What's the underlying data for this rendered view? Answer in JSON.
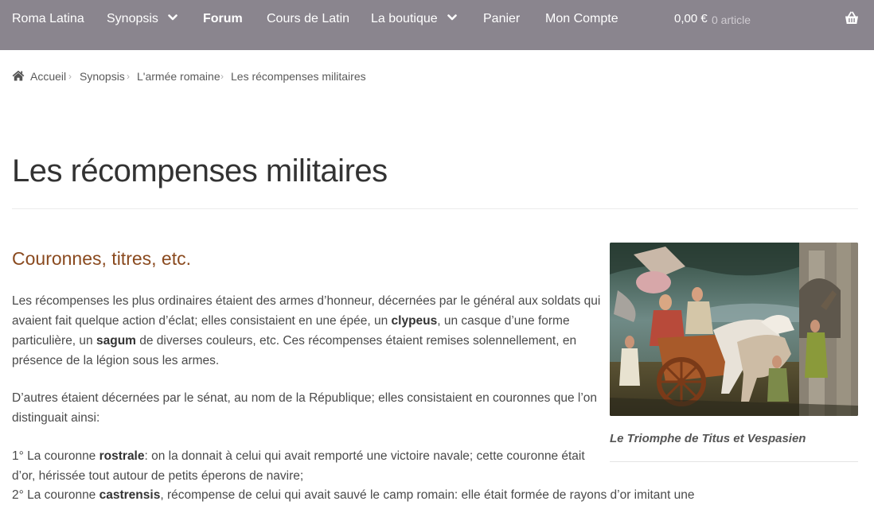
{
  "nav": {
    "items": [
      {
        "label": "Roma Latina"
      },
      {
        "label": "Synopsis"
      },
      {
        "label": "Forum"
      },
      {
        "label": "Cours de Latin"
      },
      {
        "label": "La boutique"
      },
      {
        "label": "Panier"
      },
      {
        "label": "Mon Compte"
      }
    ],
    "cart_total": "0,00 €",
    "cart_count": "0 article",
    "icons": {
      "dropdown": "chevron-down-icon",
      "cart": "basket-icon"
    },
    "bar_color": "#8a858e"
  },
  "breadcrumb": {
    "home_icon": "home-icon",
    "items": [
      "Accueil",
      "Synopsis",
      "L'armée romaine",
      "Les récompenses militaires"
    ],
    "separator": "›"
  },
  "page": {
    "title": "Les récompenses militaires",
    "section_heading": "Couronnes, titres, etc.",
    "heading_color": "#8a4a1f",
    "p1": {
      "t1": "Les récompenses les plus ordinaires étaient des armes d’honneur, décernées par le général aux soldats qui avaient fait quelque action d’éclat; elles consistaient en une épée, un ",
      "b1": "clypeus",
      "t2": ", un casque d’une forme particulière, un ",
      "b2": "sagum",
      "t3": " de diverses couleurs, etc. Ces récompenses étaient remises solennellement, en présence de la légion sous les armes."
    },
    "p2": "D’autres étaient décernées par le sénat, au nom de la République; elles consistaient en couronnes que l’on distinguait ainsi:",
    "p3": {
      "t1": "1° La couronne ",
      "b1": "rostrale",
      "t2": ": on la donnait à celui qui avait remporté une victoire navale; cette couronne était d’or, hérissée tout autour de petits éperons de navire;"
    },
    "p4": {
      "t1": "2° La couronne ",
      "b1": "castrensis",
      "t2": ", récompense de celui qui avait sauvé le camp romain: elle était formée de rayons d’or imitant une palissade;"
    }
  },
  "figure": {
    "caption": "Le Triomphe de Titus et Vespasien"
  }
}
